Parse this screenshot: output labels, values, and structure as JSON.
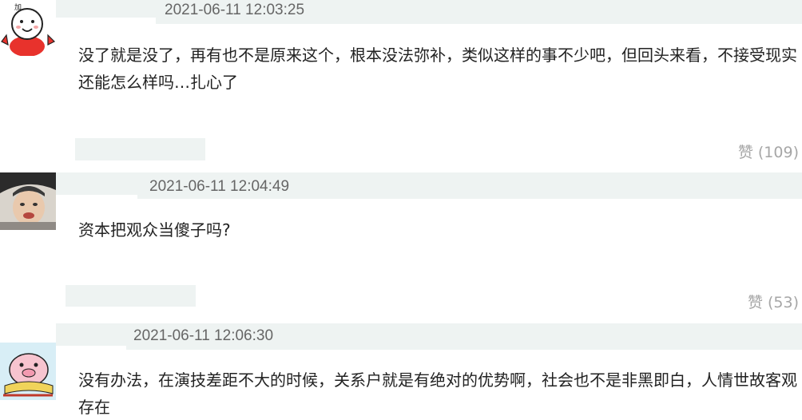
{
  "comments": [
    {
      "timestamp": "2021-06-11 12:03:25",
      "text": "没了就是没了，再有也不是原来这个，根本没法弥补，类似这样的事不少吧，但回头来看，不接受现实还能怎么样吗…扎心了",
      "likes": "赞 (109)",
      "avatar_icon": "cartoon-face-icon"
    },
    {
      "timestamp": "2021-06-11 12:04:49",
      "text": "资本把观众当傻子吗?",
      "likes": "赞 (53)",
      "avatar_icon": "photo-avatar-icon"
    },
    {
      "timestamp": "2021-06-11 12:06:30",
      "text": "没有办法，在演技差距不大的时候，关系户就是有绝对的优势啊，社会也不是非黑即白，人情世故客观存在",
      "likes": "",
      "avatar_icon": "cartoon-pig-icon"
    }
  ],
  "colors": {
    "header_bg": "#eef3f2",
    "timestamp": "#666666",
    "text": "#222222",
    "likes": "#a6a6a6"
  }
}
